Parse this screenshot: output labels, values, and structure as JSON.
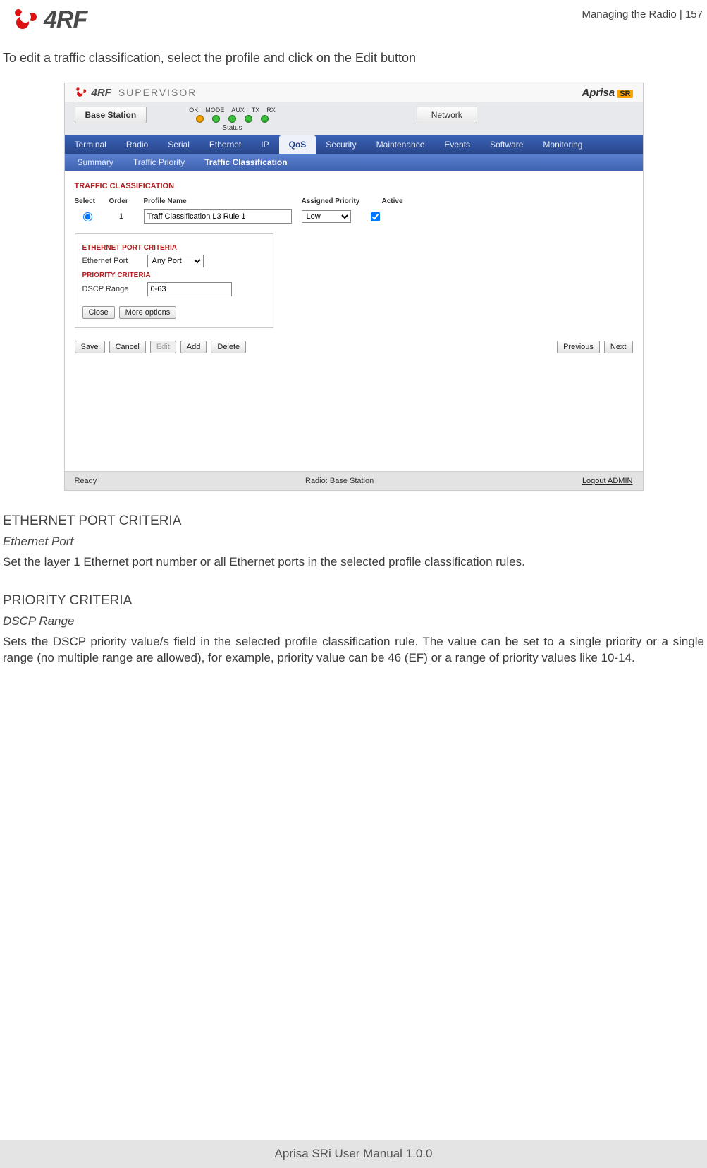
{
  "header": {
    "logo_text": "4RF",
    "right_text": "Managing the Radio  |  157"
  },
  "intro": "To edit a traffic classification, select the profile and click on the Edit button",
  "screenshot": {
    "titlebar": {
      "logo_text": "4RF",
      "supervisor": "SUPERVISOR",
      "brand": "Aprisa",
      "brand_suffix": "SR"
    },
    "status_row": {
      "base_button": "Base Station",
      "light_labels": [
        "OK",
        "MODE",
        "AUX",
        "TX",
        "RX"
      ],
      "status_label": "Status",
      "network_button": "Network"
    },
    "nav_main": [
      "Terminal",
      "Radio",
      "Serial",
      "Ethernet",
      "IP",
      "QoS",
      "Security",
      "Maintenance",
      "Events",
      "Software",
      "Monitoring"
    ],
    "nav_main_active_index": 5,
    "nav_sub": [
      "Summary",
      "Traffic Priority",
      "Traffic Classification"
    ],
    "nav_sub_active_index": 2,
    "panel": {
      "section_title": "TRAFFIC CLASSIFICATION",
      "headers": [
        "Select",
        "Order",
        "Profile Name",
        "Assigned Priority",
        "Active"
      ],
      "row": {
        "order": "1",
        "profile_name": "Traff Classification L3 Rule 1",
        "assigned_priority": "Low"
      },
      "criteria": {
        "eth_title": "ETHERNET PORT CRITERIA",
        "eth_label": "Ethernet Port",
        "eth_value": "Any Port",
        "prio_title": "PRIORITY CRITERIA",
        "dscp_label": "DSCP Range",
        "dscp_value": "0-63",
        "close": "Close",
        "more": "More options"
      },
      "buttons": {
        "save": "Save",
        "cancel": "Cancel",
        "edit": "Edit",
        "add": "Add",
        "delete": "Delete",
        "previous": "Previous",
        "next": "Next"
      }
    },
    "footer": {
      "ready": "Ready",
      "radio": "Radio: Base Station",
      "logout": "Logout ADMIN"
    }
  },
  "doc": {
    "eth_title": "ETHERNET PORT CRITERIA",
    "eth_subtitle": "Ethernet Port",
    "eth_body": "Set the layer 1 Ethernet port number or all Ethernet ports in the selected profile classification rules.",
    "prio_title": "PRIORITY CRITERIA",
    "prio_subtitle": "DSCP Range",
    "prio_body": "Sets the DSCP priority value/s field in the selected profile classification rule. The value can be set to a single priority or a single range (no multiple range are allowed), for example, priority value can be 46 (EF) or a range of priority values like 10-14."
  },
  "page_footer": "Aprisa SRi User Manual 1.0.0"
}
